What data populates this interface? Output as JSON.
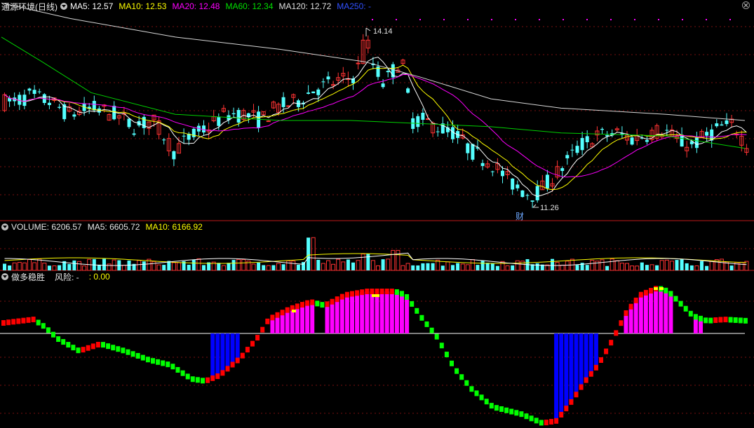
{
  "stock": {
    "name": "通源环境",
    "period": "(日线)"
  },
  "price_panel": {
    "ma_labels": [
      {
        "text": "MA5: 12.57",
        "color": "#ffffff"
      },
      {
        "text": "MA10: 12.53",
        "color": "#ffff00"
      },
      {
        "text": "MA20: 12.48",
        "color": "#ff00ff"
      },
      {
        "text": "MA60: 12.34",
        "color": "#00e000"
      },
      {
        "text": "MA120: 12.72",
        "color": "#e0e0e0"
      },
      {
        "text": "MA250: -",
        "color": "#3050ff"
      }
    ],
    "high_label": "14.14",
    "low_label": "11.26",
    "event_marker": "财"
  },
  "volume_panel": {
    "labels": [
      {
        "text": "VOLUME: 6206.57",
        "color": "#e8e8e8"
      },
      {
        "text": "MA5: 6605.72",
        "color": "#e8e8e8"
      },
      {
        "text": "MA10: 6166.92",
        "color": "#ffff00"
      }
    ]
  },
  "indicator_panel": {
    "title": "做多稳胜",
    "risk_label": "风险: -",
    "value_label": ": 0.00"
  },
  "colors": {
    "up": "#ff3333",
    "down": "#54ffff",
    "bg": "#000000",
    "grid": "#7a1010",
    "magenta": "#ff00ff",
    "red": "#ff0000",
    "green": "#00ff00",
    "blue": "#0000ff"
  },
  "chart_data": {
    "type": "candlestick",
    "price_high": 14.14,
    "price_low": 11.26,
    "ma_current": {
      "MA5": 12.57,
      "MA10": 12.53,
      "MA20": 12.48,
      "MA60": 12.34,
      "MA120": 12.72
    },
    "volume_current": 6206.57,
    "volume_ma5": 6605.72,
    "volume_ma10": 6166.92
  }
}
